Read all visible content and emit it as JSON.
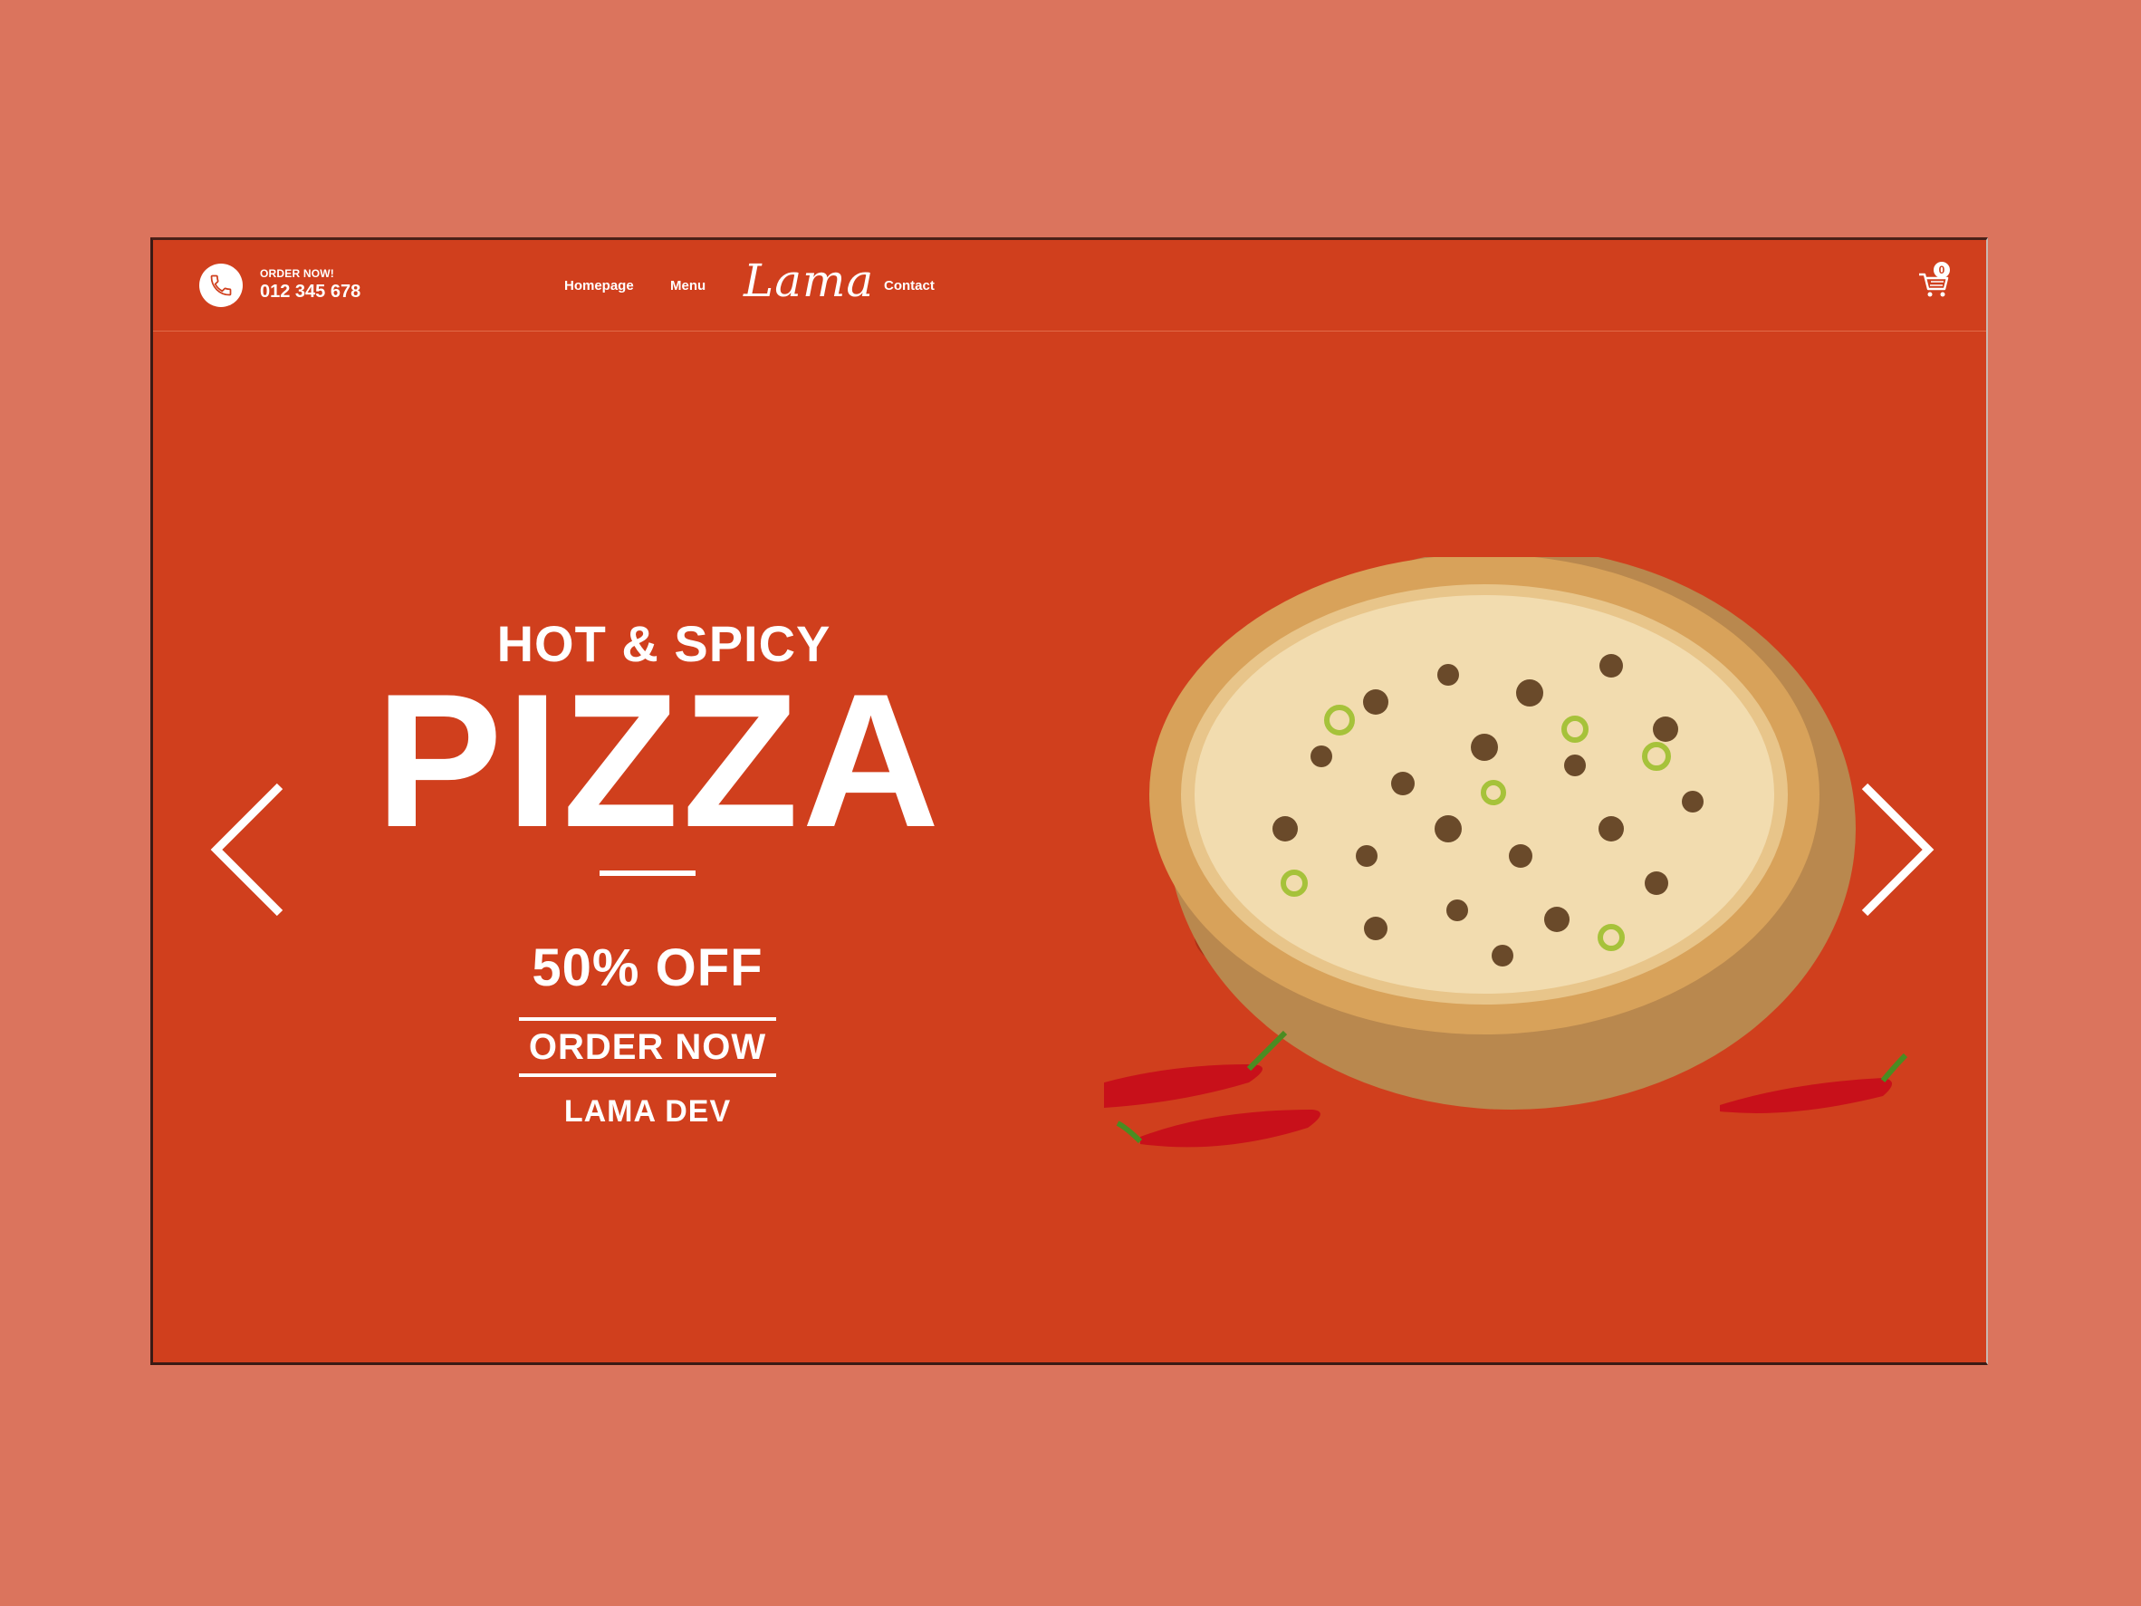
{
  "navbar": {
    "order_label": "ORDER NOW!",
    "phone_number": "012 345 678",
    "links": [
      "Homepage",
      "Menu",
      "Contact"
    ],
    "logo": "Lama",
    "cart_count": "0"
  },
  "hero": {
    "subtitle": "HOT & SPICY",
    "title": "PIZZA",
    "offer": "50% OFF",
    "cta": "ORDER NOW",
    "brand": "LAMA DEV"
  },
  "icons": {
    "phone": "phone-icon",
    "cart": "cart-icon",
    "prev": "chevron-left-icon",
    "next": "chevron-right-icon"
  },
  "colors": {
    "page_background": "#db745d",
    "hero_background": "#d03f1d",
    "text": "#ffffff"
  }
}
